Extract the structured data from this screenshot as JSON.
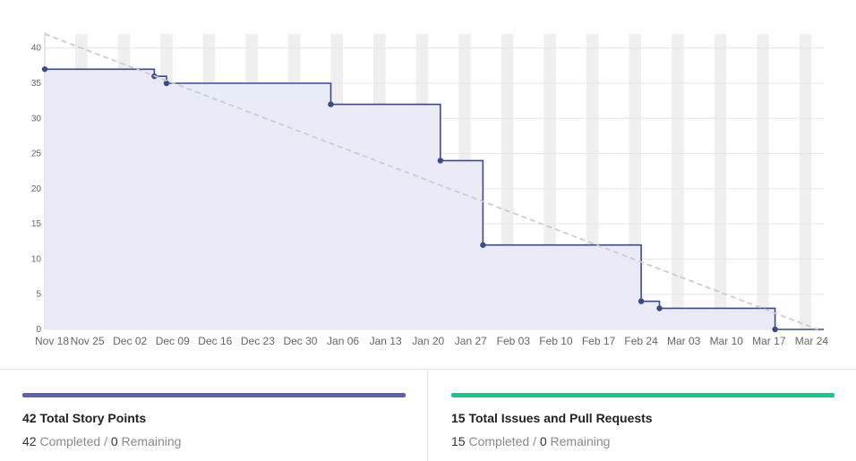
{
  "chart_data": {
    "type": "line",
    "x_unit": "week",
    "x_ticks": [
      "Nov 18",
      "Nov 25",
      "Dec 02",
      "Dec 09",
      "Dec 16",
      "Dec 23",
      "Dec 30",
      "Jan 06",
      "Jan 13",
      "Jan 20",
      "Jan 27",
      "Feb 03",
      "Feb 10",
      "Feb 17",
      "Feb 24",
      "Mar 03",
      "Mar 10",
      "Mar 17",
      "Mar 24"
    ],
    "ylim": [
      0,
      42
    ],
    "y_ticks": [
      0,
      5,
      10,
      15,
      20,
      25,
      30,
      35,
      40
    ],
    "weekend_shading": true,
    "grid": true,
    "series": [
      {
        "style": "step",
        "color": "#3b4a8f",
        "fill": "#e9e9f6",
        "points": [
          {
            "x": "2019-11-18",
            "y": 37
          },
          {
            "x": "2019-12-06",
            "y": 36
          },
          {
            "x": "2019-12-08",
            "y": 35
          },
          {
            "x": "2020-01-04",
            "y": 32
          },
          {
            "x": "2020-01-22",
            "y": 24
          },
          {
            "x": "2020-01-29",
            "y": 12
          },
          {
            "x": "2020-02-24",
            "y": 4
          },
          {
            "x": "2020-02-27",
            "y": 3
          },
          {
            "x": "2020-03-17",
            "y": 0
          },
          {
            "x": "2020-03-25",
            "y": 0
          }
        ]
      },
      {
        "style": "dashed",
        "color": "#cccccc",
        "points": [
          {
            "x": "2019-11-18",
            "y": 42
          },
          {
            "x": "2020-03-24",
            "y": 0
          }
        ]
      }
    ]
  },
  "footer": {
    "story": {
      "bar_color": "#5c5fb3",
      "title": "42 Total Story Points",
      "completed": "42",
      "completed_label": "Completed",
      "sep": "/",
      "remaining": "0",
      "remaining_label": "Remaining"
    },
    "issues": {
      "bar_color": "#13c98b",
      "title": "15 Total Issues and Pull Requests",
      "completed": "15",
      "completed_label": "Completed",
      "sep": "/",
      "remaining": "0",
      "remaining_label": "Remaining"
    }
  }
}
